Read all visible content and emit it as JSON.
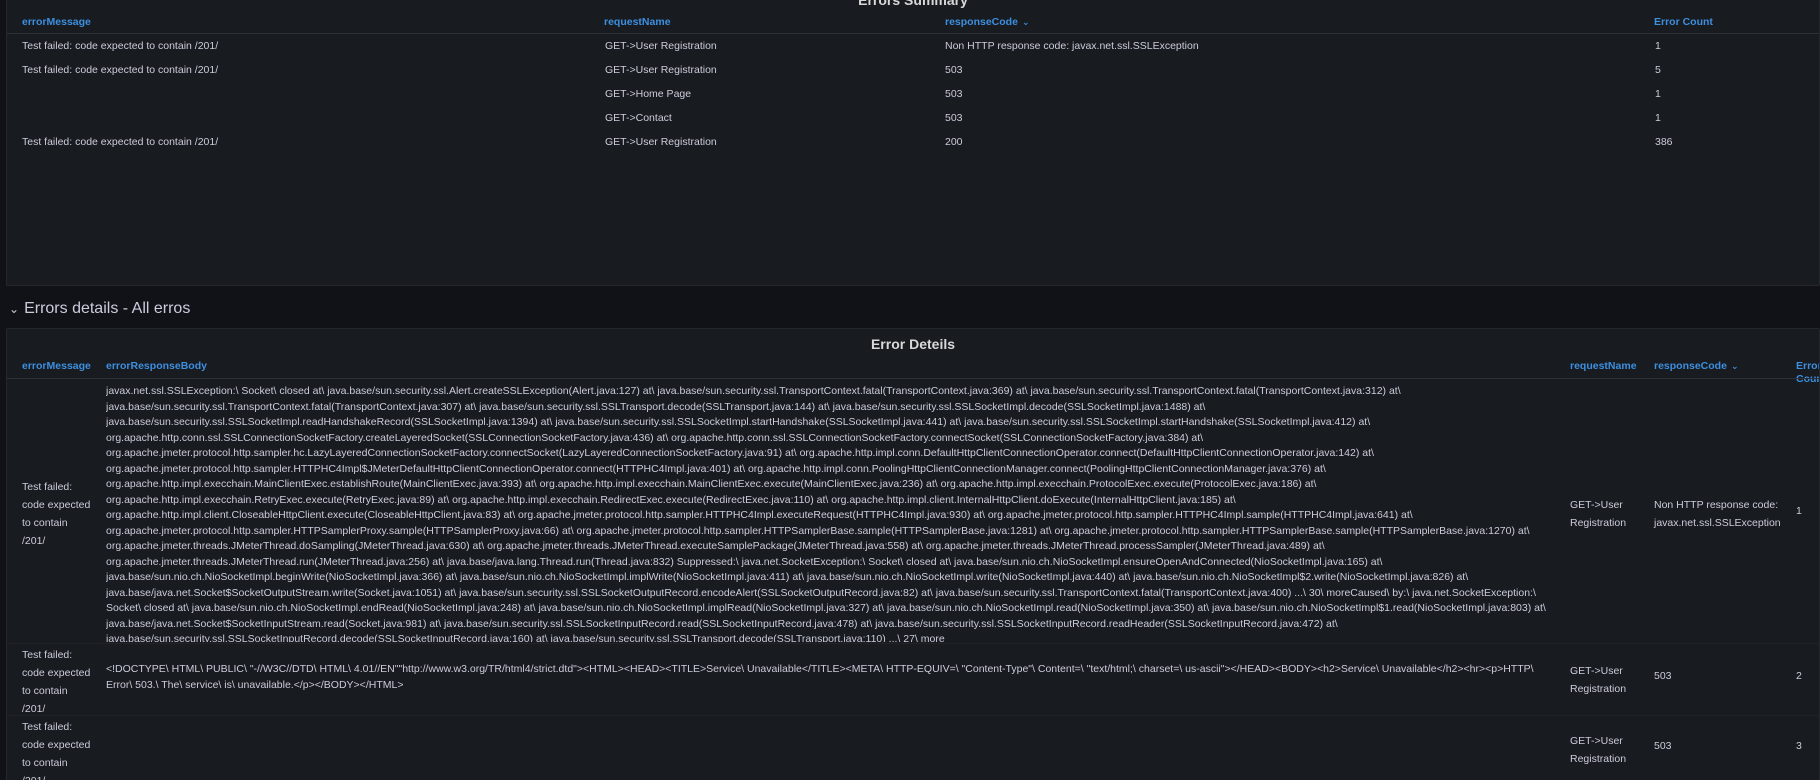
{
  "summary": {
    "title": "Errors Summary",
    "columns": {
      "errorMessage": "errorMessage",
      "requestName": "requestName",
      "responseCode": "responseCode",
      "errorCount": "Error Count"
    },
    "rows": [
      {
        "errorMessage": "Test failed: code expected to contain /201/",
        "requestName": "GET->User Registration",
        "responseCode": "Non HTTP response code: javax.net.ssl.SSLException",
        "errorCount": "1"
      },
      {
        "errorMessage": "Test failed: code expected to contain /201/",
        "requestName": "GET->User Registration",
        "responseCode": "503",
        "errorCount": "5"
      },
      {
        "errorMessage": "",
        "requestName": "GET->Home Page",
        "responseCode": "503",
        "errorCount": "1"
      },
      {
        "errorMessage": "",
        "requestName": "GET->Contact",
        "responseCode": "503",
        "errorCount": "1"
      },
      {
        "errorMessage": "Test failed: code expected to contain /201/",
        "requestName": "GET->User Registration",
        "responseCode": "200",
        "errorCount": "386"
      }
    ]
  },
  "section": {
    "title": "Errors details - All erros"
  },
  "details": {
    "title": "Error Deteils",
    "columns": {
      "errorMessage": "errorMessage",
      "errorResponseBody": "errorResponseBody",
      "requestName": "requestName",
      "responseCode": "responseCode",
      "errorCount": "Error Count"
    },
    "rows": [
      {
        "errorMessage": "Test failed: code expected to contain /201/",
        "errorResponseBody": "javax.net.ssl.SSLException:\\ Socket\\ closed at\\ java.base/sun.security.ssl.Alert.createSSLException(Alert.java:127) at\\ java.base/sun.security.ssl.TransportContext.fatal(TransportContext.java:369) at\\ java.base/sun.security.ssl.TransportContext.fatal(TransportContext.java:312) at\\ java.base/sun.security.ssl.TransportContext.fatal(TransportContext.java:307) at\\ java.base/sun.security.ssl.SSLTransport.decode(SSLTransport.java:144) at\\ java.base/sun.security.ssl.SSLSocketImpl.decode(SSLSocketImpl.java:1488) at\\ java.base/sun.security.ssl.SSLSocketImpl.readHandshakeRecord(SSLSocketImpl.java:1394) at\\ java.base/sun.security.ssl.SSLSocketImpl.startHandshake(SSLSocketImpl.java:441) at\\ java.base/sun.security.ssl.SSLSocketImpl.startHandshake(SSLSocketImpl.java:412) at\\ org.apache.http.conn.ssl.SSLConnectionSocketFactory.createLayeredSocket(SSLConnectionSocketFactory.java:436) at\\ org.apache.http.conn.ssl.SSLConnectionSocketFactory.connectSocket(SSLConnectionSocketFactory.java:384) at\\ org.apache.jmeter.protocol.http.sampler.hc.LazyLayeredConnectionSocketFactory.connectSocket(LazyLayeredConnectionSocketFactory.java:91) at\\ org.apache.http.impl.conn.DefaultHttpClientConnectionOperator.connect(DefaultHttpClientConnectionOperator.java:142) at\\ org.apache.jmeter.protocol.http.sampler.HTTPHC4Impl$JMeterDefaultHttpClientConnectionOperator.connect(HTTPHC4Impl.java:401) at\\ org.apache.http.impl.conn.PoolingHttpClientConnectionManager.connect(PoolingHttpClientConnectionManager.java:376) at\\ org.apache.http.impl.execchain.MainClientExec.establishRoute(MainClientExec.java:393) at\\ org.apache.http.impl.execchain.MainClientExec.execute(MainClientExec.java:236) at\\ org.apache.http.impl.execchain.ProtocolExec.execute(ProtocolExec.java:186) at\\ org.apache.http.impl.execchain.RetryExec.execute(RetryExec.java:89) at\\ org.apache.http.impl.execchain.RedirectExec.execute(RedirectExec.java:110) at\\ org.apache.http.impl.client.InternalHttpClient.doExecute(InternalHttpClient.java:185) at\\ org.apache.http.impl.client.CloseableHttpClient.execute(CloseableHttpClient.java:83) at\\ org.apache.jmeter.protocol.http.sampler.HTTPHC4Impl.executeRequest(HTTPHC4Impl.java:930) at\\ org.apache.jmeter.protocol.http.sampler.HTTPHC4Impl.sample(HTTPHC4Impl.java:641) at\\ org.apache.jmeter.protocol.http.sampler.HTTPSamplerProxy.sample(HTTPSamplerProxy.java:66) at\\ org.apache.jmeter.protocol.http.sampler.HTTPSamplerBase.sample(HTTPSamplerBase.java:1281) at\\ org.apache.jmeter.protocol.http.sampler.HTTPSamplerBase.sample(HTTPSamplerBase.java:1270) at\\ org.apache.jmeter.threads.JMeterThread.doSampling(JMeterThread.java:630) at\\ org.apache.jmeter.threads.JMeterThread.executeSamplePackage(JMeterThread.java:558) at\\ org.apache.jmeter.threads.JMeterThread.processSampler(JMeterThread.java:489) at\\ org.apache.jmeter.threads.JMeterThread.run(JMeterThread.java:256) at\\ java.base/java.lang.Thread.run(Thread.java:832) Suppressed:\\ java.net.SocketException:\\ Socket\\ closed at\\ java.base/sun.nio.ch.NioSocketImpl.ensureOpenAndConnected(NioSocketImpl.java:165) at\\ java.base/sun.nio.ch.NioSocketImpl.beginWrite(NioSocketImpl.java:366) at\\ java.base/sun.nio.ch.NioSocketImpl.implWrite(NioSocketImpl.java:411) at\\ java.base/sun.nio.ch.NioSocketImpl.write(NioSocketImpl.java:440) at\\ java.base/sun.nio.ch.NioSocketImpl$2.write(NioSocketImpl.java:826) at\\ java.base/java.net.Socket$SocketOutputStream.write(Socket.java:1051) at\\ java.base/sun.security.ssl.SSLSocketOutputRecord.encodeAlert(SSLSocketOutputRecord.java:82) at\\ java.base/sun.security.ssl.TransportContext.fatal(TransportContext.java:400) ...\\ 30\\ moreCaused\\ by:\\ java.net.SocketException:\\ Socket\\ closed at\\ java.base/sun.nio.ch.NioSocketImpl.endRead(NioSocketImpl.java:248) at\\ java.base/sun.nio.ch.NioSocketImpl.implRead(NioSocketImpl.java:327) at\\ java.base/sun.nio.ch.NioSocketImpl.read(NioSocketImpl.java:350) at\\ java.base/sun.nio.ch.NioSocketImpl$1.read(NioSocketImpl.java:803) at\\ java.base/java.net.Socket$SocketInputStream.read(Socket.java:981) at\\ java.base/sun.security.ssl.SSLSocketInputRecord.read(SSLSocketInputRecord.java:478) at\\ java.base/sun.security.ssl.SSLSocketInputRecord.readHeader(SSLSocketInputRecord.java:472) at\\ java.base/sun.security.ssl.SSLSocketInputRecord.decode(SSLSocketInputRecord.java:160) at\\ java.base/sun.security.ssl.SSLTransport.decode(SSLTransport.java:110) ...\\ 27\\ more",
        "requestName": "GET->User Registration",
        "responseCode": "Non HTTP response code: javax.net.ssl.SSLException",
        "errorCount": "1"
      },
      {
        "errorMessage": "Test failed: code expected to contain /201/",
        "errorResponseBody": "<!DOCTYPE\\ HTML\\ PUBLIC\\ \"-//W3C//DTD\\ HTML\\ 4.01//EN\"\"http://www.w3.org/TR/html4/strict.dtd\"><HTML><HEAD><TITLE>Service\\ Unavailable</TITLE><META\\ HTTP-EQUIV=\\ \"Content-Type\"\\ Content=\\ \"text/html;\\ charset=\\ us-ascii\"></HEAD><BODY><h2>Service\\ Unavailable</h2><hr><p>HTTP\\ Error\\ 503.\\ The\\ service\\ is\\ unavailable.</p></BODY></HTML>",
        "requestName": "GET->User Registration",
        "responseCode": "503",
        "errorCount": "2"
      },
      {
        "errorMessage": "Test failed: code expected to contain /201/",
        "errorResponseBody": "",
        "requestName": "GET->User Registration",
        "responseCode": "503",
        "errorCount": "3"
      }
    ]
  }
}
